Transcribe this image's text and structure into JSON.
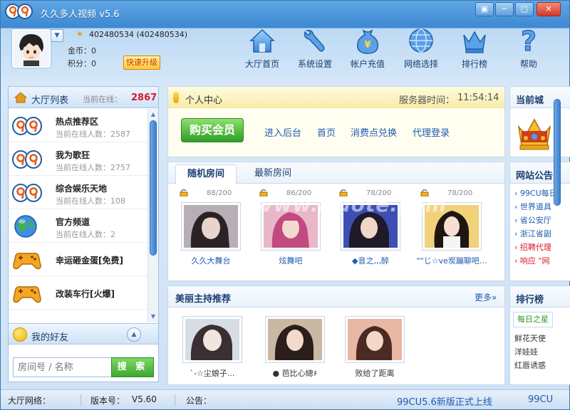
{
  "app": {
    "title": "久久多人视频 v5.6"
  },
  "window_buttons": {
    "menu": "▣",
    "minimize": "─",
    "close": "✕"
  },
  "user": {
    "id_text": "402480534 (402480534)",
    "coin_label": "金币：",
    "coin_value": "0",
    "points_label": "积分：",
    "points_value": "0",
    "upgrade_label": "快速升级"
  },
  "toolbar": [
    {
      "label": "大厅首页",
      "icon": "house-icon"
    },
    {
      "label": "系统设置",
      "icon": "wrench-icon"
    },
    {
      "label": "帐户充值",
      "icon": "money-bag-icon"
    },
    {
      "label": "网络选择",
      "icon": "globe-icon"
    },
    {
      "label": "排行榜",
      "icon": "crown-icon"
    },
    {
      "label": "帮助",
      "icon": "question-icon"
    }
  ],
  "hall": {
    "title": "大厅列表",
    "online_label": "当前在线：",
    "online_count": "2867",
    "items": [
      {
        "name": "热点推荐区",
        "stat": "当前在线人数：2587",
        "icon": "chat-logo-icon"
      },
      {
        "name": "我为歌狂",
        "stat": "当前在线人数：2757",
        "icon": "chat-logo-icon"
      },
      {
        "name": "综合娱乐天地",
        "stat": "当前在线人数：108",
        "icon": "chat-logo-icon"
      },
      {
        "name": "官方频道",
        "stat": "当前在线人数：2",
        "icon": "globe-icon"
      },
      {
        "name": "幸运砸金蛋[免费]",
        "stat": "",
        "icon": "gamepad-icon"
      },
      {
        "name": "改装车行[火爆]",
        "stat": "",
        "icon": "gamepad-icon"
      }
    ]
  },
  "friends": {
    "title": "我的好友"
  },
  "search": {
    "placeholder": "房间号 / 名称",
    "button": "搜 索"
  },
  "personal": {
    "title": "个人中心",
    "time_label": "服务器时间：",
    "time_value": "11:54:14",
    "buy_vip": "购买会员",
    "links": [
      "进入后台",
      "首页",
      "消费点兑换",
      "代理登录"
    ]
  },
  "rooms": {
    "tabs": [
      "随机房间",
      "最新房间"
    ],
    "items": [
      {
        "capacity": "88/200",
        "name": "久久大舞台"
      },
      {
        "capacity": "86/200",
        "name": "炫舞吧"
      },
      {
        "capacity": "78/200",
        "name": "◆音之,,,醉"
      },
      {
        "capacity": "78/200",
        "name": "\"\"じ☆ve炭蹦聊吧..."
      }
    ]
  },
  "hosts": {
    "title": "美丽主持推荐",
    "more": "更多»",
    "items": [
      {
        "name": "`-☆尘娘子..."
      },
      {
        "name": "● 芭比心總۶"
      },
      {
        "name": "败给了距离"
      }
    ]
  },
  "right": {
    "region_title": "当前城",
    "news_title": "网站公告",
    "news": [
      {
        "text": "› 99CU每日",
        "red": false
      },
      {
        "text": "› 世界道具",
        "red": false
      },
      {
        "text": "› 省公安厅",
        "red": false
      },
      {
        "text": "› 浙江省副",
        "red": false
      },
      {
        "text": "› 招聘代理",
        "red": true
      },
      {
        "text": "› 响应 \"网",
        "red": true
      }
    ],
    "rank_title": "排行榜",
    "rank_tab": "每日之星",
    "rank_items": [
      "鲜花天使",
      "洋娃娃",
      "红唇诱惑"
    ]
  },
  "status": {
    "network_label": "大厅网络：",
    "version_label": "版本号：",
    "version_value": "V5.60",
    "notice_label": "公告：",
    "notice_text": "99CU5.6新版正式上线",
    "notice_text2": "99CU"
  },
  "watermark": {
    "text": "www.Duote.com"
  }
}
